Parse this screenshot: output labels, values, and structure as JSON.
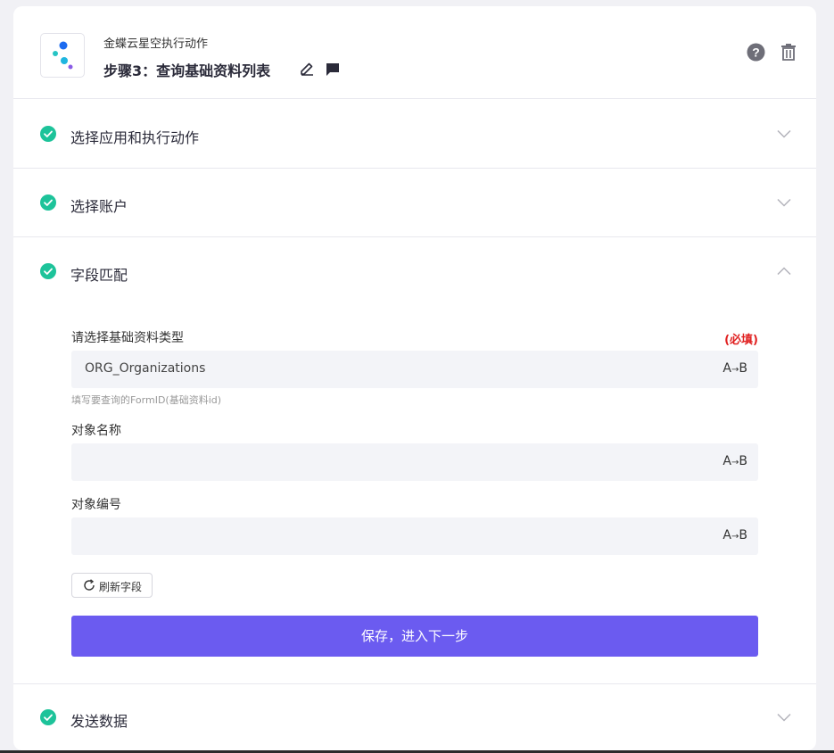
{
  "header": {
    "app_name": "金蝶云星空执行动作",
    "step_title": "步骤3：查询基础资料列表"
  },
  "sections": [
    {
      "label": "选择应用和执行动作",
      "expanded": false
    },
    {
      "label": "选择账户",
      "expanded": false
    },
    {
      "label": "字段匹配",
      "expanded": true
    },
    {
      "label": "发送数据",
      "expanded": false
    }
  ],
  "form": {
    "fields": [
      {
        "label": "请选择基础资料类型",
        "required": "(必填)",
        "value": "ORG_Organizations",
        "hint": "填写要查询的FormID(基础资料id)"
      },
      {
        "label": "对象名称",
        "value": ""
      },
      {
        "label": "对象编号",
        "value": ""
      }
    ],
    "ab_text": "A",
    "ab_arrow": "→",
    "ab_text2": "B",
    "refresh_label": "刷新字段",
    "save_label": "保存，进入下一步"
  },
  "colors": {
    "check": "#1dc39a",
    "primary": "#6b5bf0",
    "required": "#e02020"
  }
}
